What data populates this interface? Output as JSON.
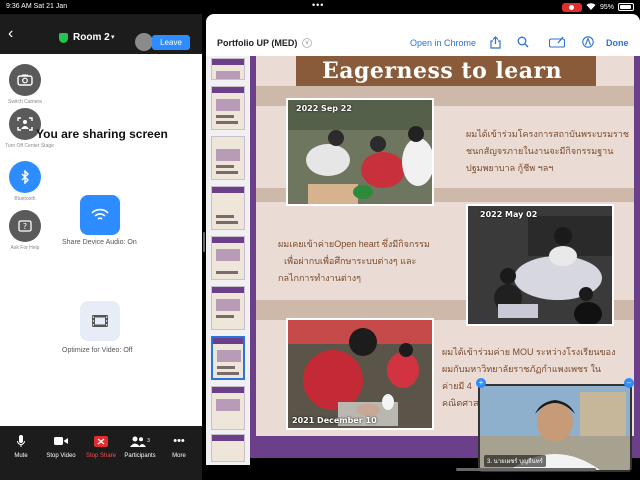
{
  "status_bar": {
    "time": "9:36 AM  Sat 21 Jan",
    "battery": "95%"
  },
  "zoom": {
    "room_name": "Room 2",
    "leave_label": "Leave",
    "side_buttons": [
      {
        "label": "Switch Camera",
        "icon": "camera-switch-icon"
      },
      {
        "label": "Turn Off Center Stage",
        "icon": "center-stage-icon"
      },
      {
        "label": "Bluetooth",
        "icon": "bluetooth-icon"
      },
      {
        "label": "Ask For Help",
        "icon": "help-icon"
      }
    ],
    "sharing_text": "You are sharing screen",
    "share_audio_label": "Share Device Audio: On",
    "optimize_label": "Optimize for Video: Off",
    "toolbar": {
      "mute": "Mute",
      "stop_video": "Stop Video",
      "stop_share": "Stop Share",
      "participants": "Participants",
      "participants_count": "3",
      "more": "More"
    }
  },
  "doc": {
    "title": "Portfolio UP (MED)",
    "open_in_chrome": "Open in Chrome",
    "done": "Done",
    "headline": "Eagerness to learn",
    "photo_dates": [
      "2022 Sep 22",
      "2022 May 02",
      "2021 December  10"
    ],
    "text_block_1": [
      "ผมได้เข้าร่วมโครงการสถาบันพระบรมราช",
      "ชนกสัญจรภายในงานจะมีกิจกรรมฐาน",
      "ปฐมพยาบาล กู้ชีพ ฯลฯ"
    ],
    "text_block_2": [
      "ผมเคยเข้าค่ายOpen heart ซึ่งมีกิจกรรม",
      "เพื่อผ่ากบเพื่อศึกษาระบบต่างๆ และ",
      "กลไกการทำงานต่างๆ"
    ],
    "text_block_3": [
      "ผมได้เข้าร่วมค่าย MOU ระหว่างโรงเรียนของ",
      "ผมกับมหาวิทยาลัยราชภัฏกำแพงเพชร ใน",
      "ค่ายมี 4",
      "คณิตศาสตร์"
    ],
    "self_view_name": "3. นายเผชร์ บุญยืนทร์"
  },
  "colors": {
    "zoom_blue": "#2d8cff",
    "page_purple": "#6b3f8a",
    "page_bg": "#eadcd4",
    "link_blue": "#2b73d6"
  }
}
